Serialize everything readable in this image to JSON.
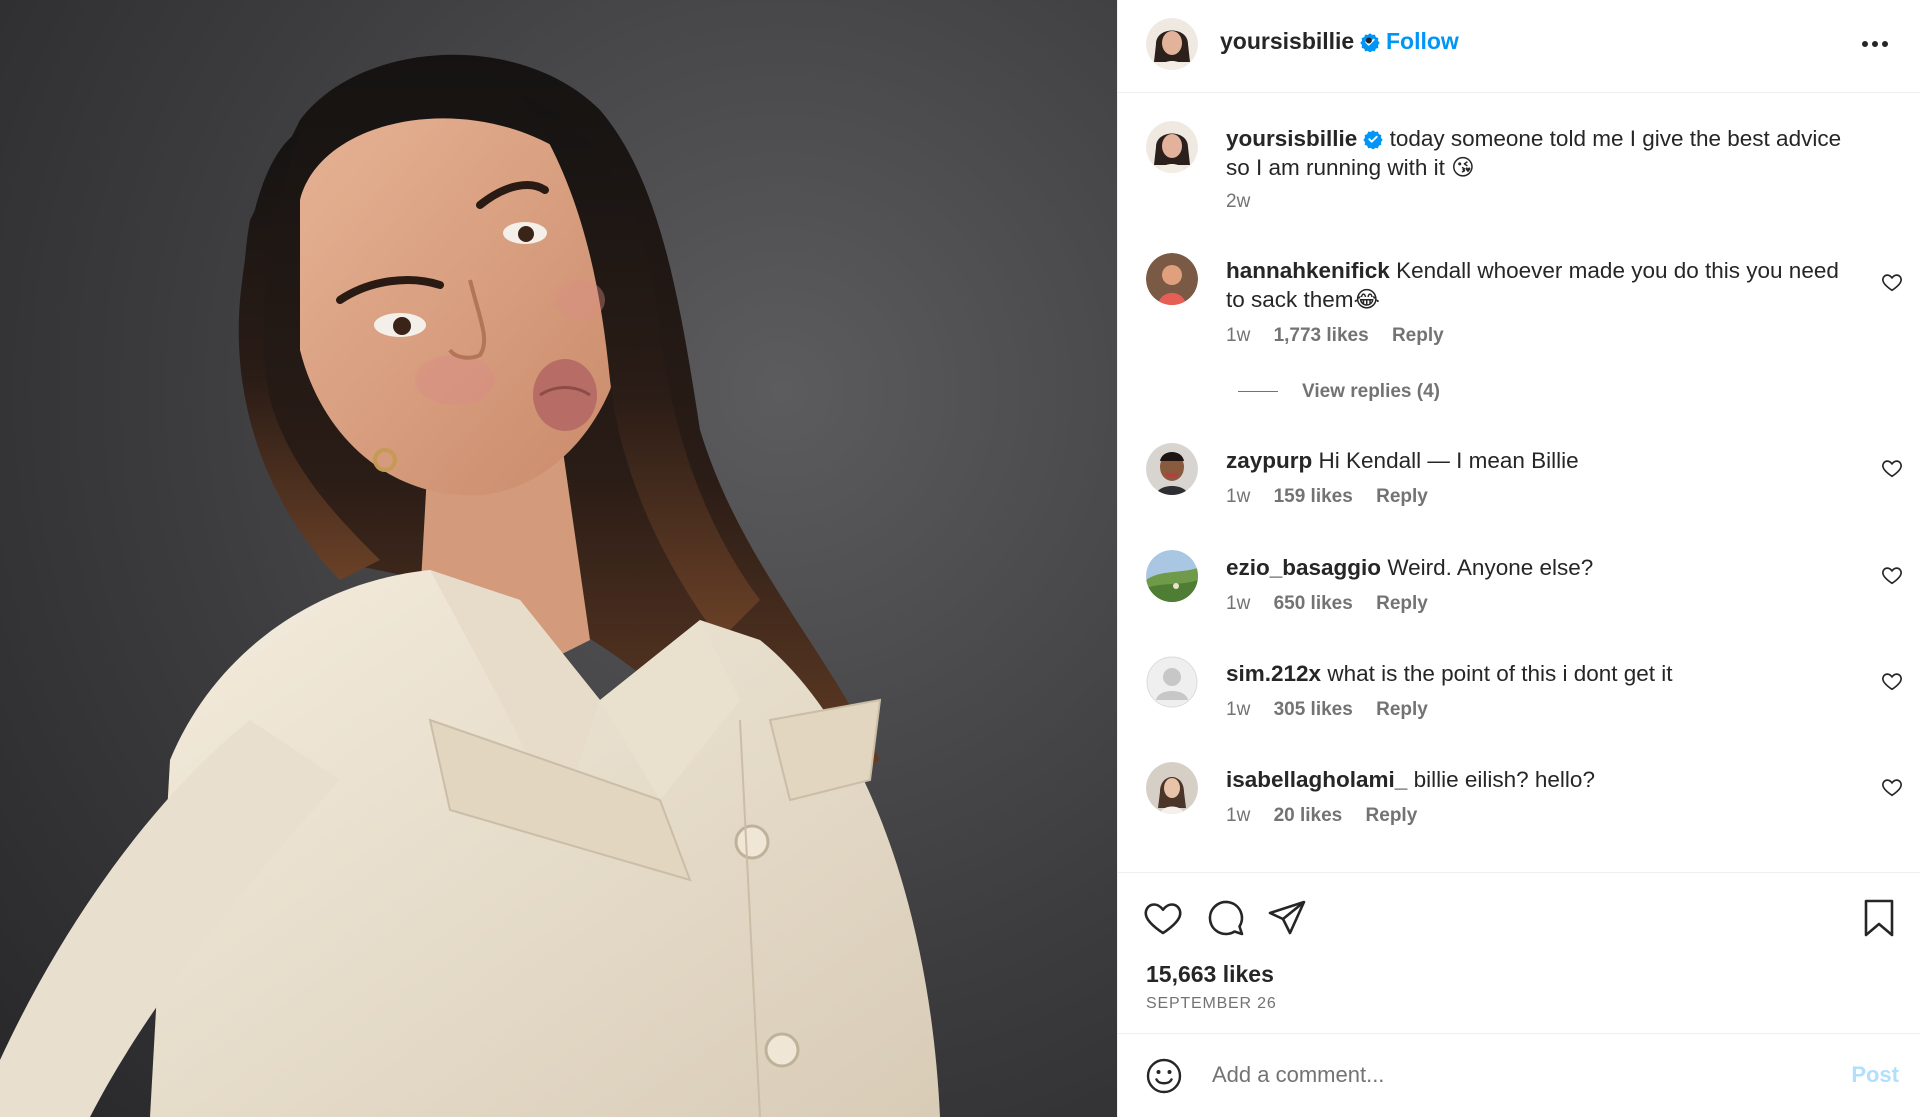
{
  "post": {
    "username": "yoursisbillie",
    "follow_label": "Follow",
    "separator": "•",
    "photo_icon": "portrait-photo",
    "more_icon": "more-horizontal-icon"
  },
  "caption": {
    "username": "yoursisbillie",
    "text": "today someone told me I give the best advice so I am running with it 😘",
    "time": "2w"
  },
  "comments": [
    {
      "username": "hannahkenifick",
      "text": "Kendall whoever made you do this you need to sack them😂",
      "time": "1w",
      "likes": "1,773 likes",
      "reply": "Reply",
      "view_replies": "View replies (4)"
    },
    {
      "username": "zaypurp",
      "text": "Hi Kendall — I mean Billie",
      "time": "1w",
      "likes": "159 likes",
      "reply": "Reply"
    },
    {
      "username": "ezio_basaggio",
      "text": "Weird. Anyone else?",
      "time": "1w",
      "likes": "650 likes",
      "reply": "Reply"
    },
    {
      "username": "sim.212x",
      "text": "what is the point of this i dont get it",
      "time": "1w",
      "likes": "305 likes",
      "reply": "Reply"
    },
    {
      "username": "isabellagholami_",
      "text": "billie eilish? hello?",
      "time": "1w",
      "likes": "20 likes",
      "reply": "Reply"
    }
  ],
  "actions": {
    "likes": "15,663 likes",
    "date": "SEPTEMBER 26",
    "icons": [
      "heart-icon",
      "comment-icon",
      "share-icon",
      "bookmark-icon"
    ]
  },
  "add_comment": {
    "placeholder": "Add a comment...",
    "post_label": "Post"
  },
  "colors": {
    "link_blue": "#0095f6",
    "post_disabled": "#b2dffc",
    "text": "#262626",
    "muted": "#737373"
  }
}
